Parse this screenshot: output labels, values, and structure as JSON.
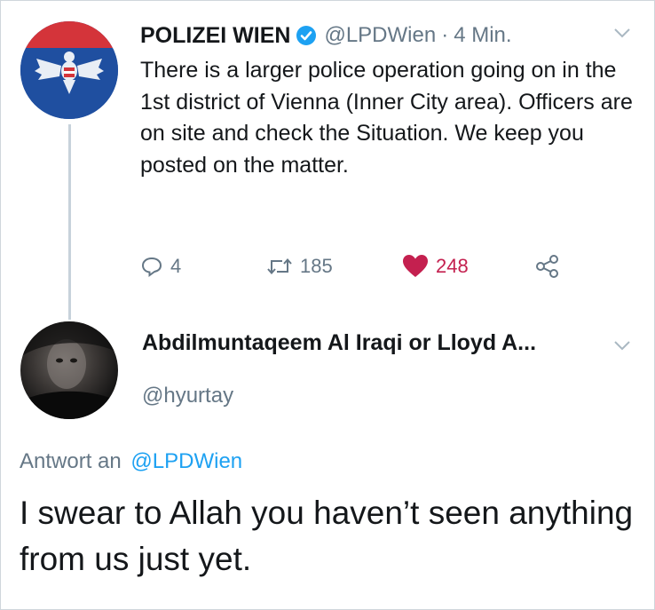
{
  "tweet": {
    "author_name": "POLIZEI WIEN",
    "handle": "@LPDWien",
    "separator": "·",
    "time": "4 Min.",
    "text": "There is a larger police operation going on in the 1st district of Vienna (Inner City area). Officers are on site and check the Situation. We keep you posted on the matter.",
    "replies": "4",
    "retweets": "185",
    "likes": "248",
    "icons": [
      "verified-badge-icon",
      "reply-icon",
      "retweet-icon",
      "heart-icon",
      "share-icon",
      "chevron-down-icon"
    ],
    "colors": {
      "like": "#c4204f",
      "mention": "#1da1f2",
      "verified": "#1da1f2",
      "muted": "#657786"
    }
  },
  "reply": {
    "author_name": "Abdilmuntaqeem Al Iraqi or Lloyd A...",
    "handle": "@hyurtay",
    "reply_to_label": "Antwort an",
    "reply_to_handle": "@LPDWien",
    "text": "I swear to Allah you haven’t seen anything from us just yet."
  }
}
